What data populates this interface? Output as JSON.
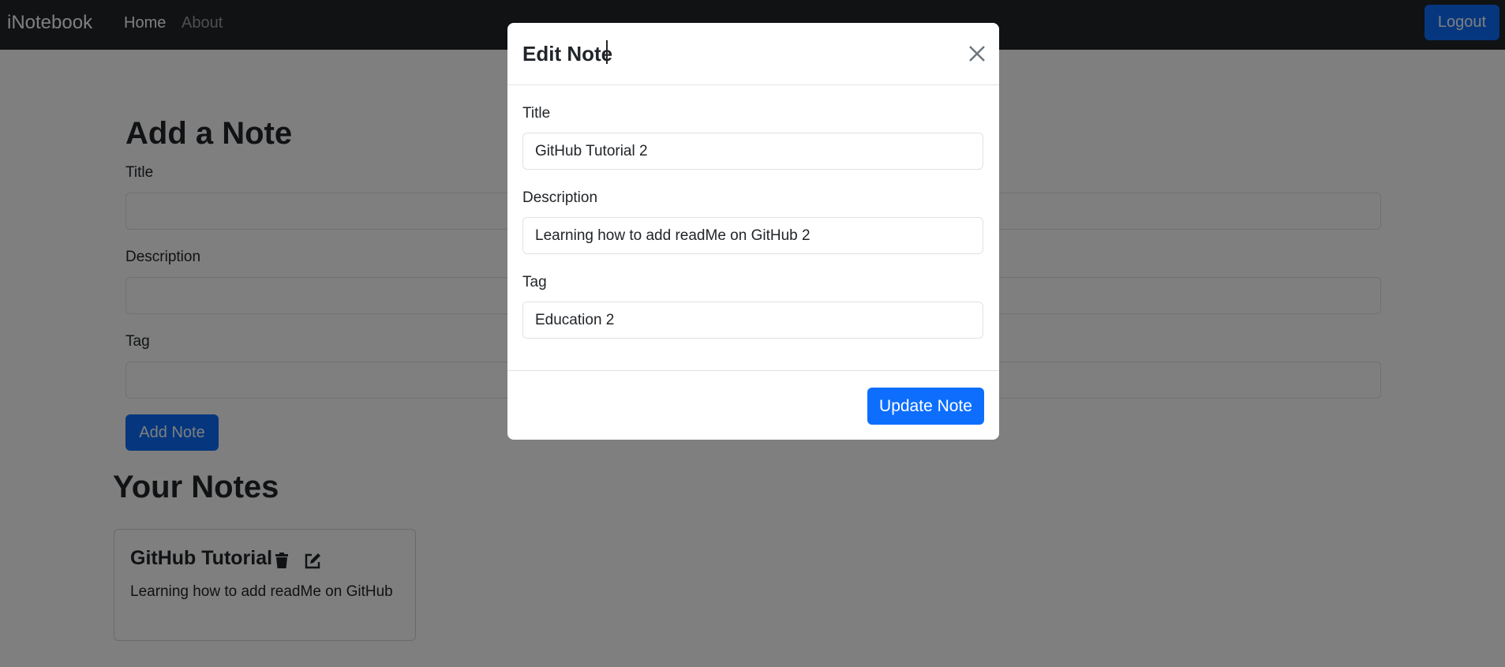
{
  "navbar": {
    "brand": "iNotebook",
    "links": [
      {
        "label": "Home"
      },
      {
        "label": "About"
      }
    ],
    "logout_label": "Logout"
  },
  "add_note": {
    "heading": "Add a Note",
    "title_label": "Title",
    "description_label": "Description",
    "tag_label": "Tag",
    "button_label": "Add Note"
  },
  "notes": {
    "heading": "Your Notes",
    "items": [
      {
        "title": "GitHub Tutorial",
        "description": "Learning how to add readMe on GitHub"
      }
    ]
  },
  "modal": {
    "title": "Edit Note",
    "title_label": "Title",
    "title_value": "GitHub Tutorial 2",
    "description_label": "Description",
    "description_value": "Learning how to add readMe on GitHub 2",
    "tag_label": "Tag",
    "tag_value": "Education 2",
    "update_label": "Update Note"
  },
  "colors": {
    "navbar_bg": "#212529",
    "primary": "#0d6efd",
    "backdrop": "rgba(0,0,0,0.5)"
  },
  "icons": {
    "delete": "trash-icon",
    "edit": "edit-icon",
    "close": "close-icon"
  }
}
